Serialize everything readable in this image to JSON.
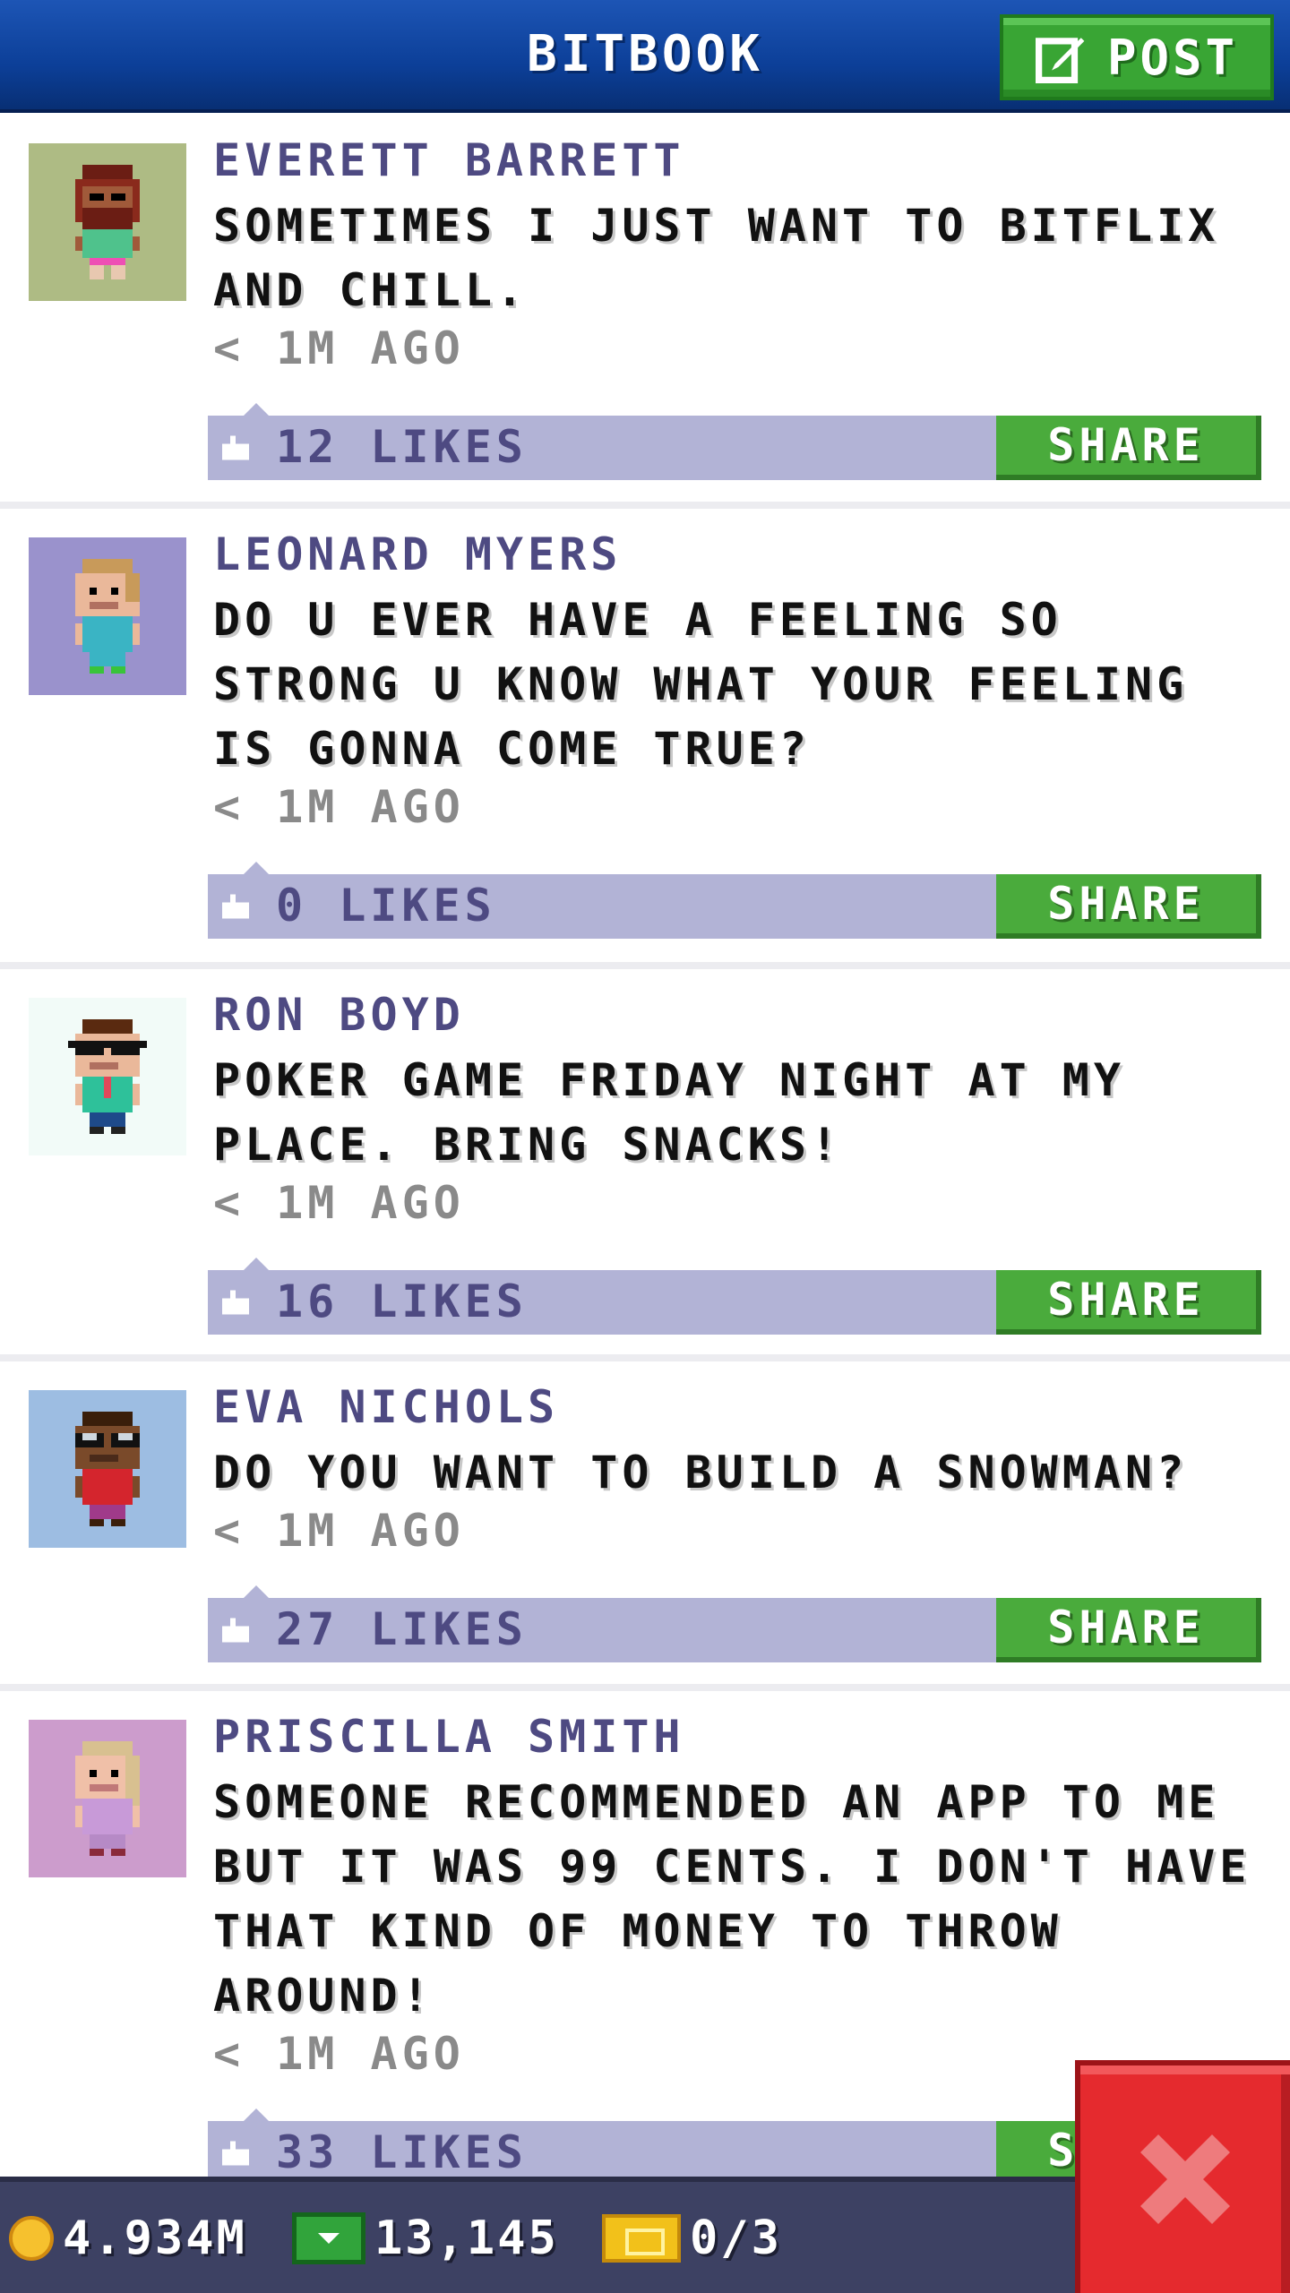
{
  "header": {
    "title": "BITBOOK",
    "post_label": "POST"
  },
  "posts": [
    {
      "author": "EVERETT BARRETT",
      "message": "SOMETIMES I JUST WANT TO BITFLIX AND CHILL.",
      "time": "< 1M AGO",
      "likes": "12 LIKES",
      "share": "SHARE",
      "avatar_bg": "#aebb84"
    },
    {
      "author": "LEONARD MYERS",
      "message": "DO U EVER HAVE A FEELING SO STRONG U KNOW WHAT YOUR FEELING IS GONNA COME TRUE?",
      "time": "< 1M AGO",
      "likes": "0 LIKES",
      "share": "SHARE",
      "avatar_bg": "#9a92cc"
    },
    {
      "author": "RON BOYD",
      "message": "POKER GAME FRIDAY NIGHT AT MY PLACE. BRING SNACKS!",
      "time": "< 1M AGO",
      "likes": "16 LIKES",
      "share": "SHARE",
      "avatar_bg": "#f2fbf8"
    },
    {
      "author": "EVA NICHOLS",
      "message": "DO YOU WANT TO BUILD A SNOWMAN?",
      "time": "< 1M AGO",
      "likes": "27 LIKES",
      "share": "SHARE",
      "avatar_bg": "#9dbde2"
    },
    {
      "author": "PRISCILLA SMITH",
      "message": "SOMEONE RECOMMENDED AN APP TO ME BUT IT WAS 99 CENTS. I DON'T HAVE THAT KIND OF MONEY TO THROW AROUND!",
      "time": "< 1M AGO",
      "likes": "33 LIKES",
      "share": "SHARE",
      "avatar_bg": "#cc9ccc"
    }
  ],
  "footer": {
    "coins": "4.934M",
    "cash": "13,145",
    "tickets": "0/3"
  },
  "icons": {
    "post": "edit-icon",
    "like": "thumbs-up-icon",
    "coin": "coin-icon",
    "cash": "cash-icon",
    "ticket": "ticket-icon",
    "close": "close-icon"
  }
}
